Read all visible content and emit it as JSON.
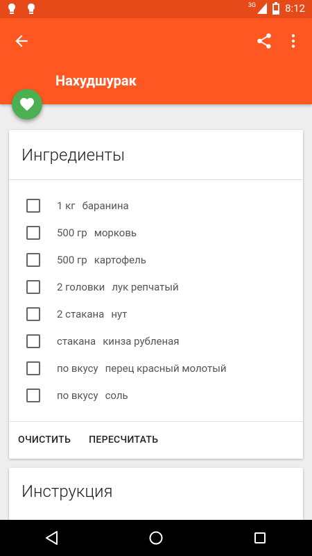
{
  "status_bar": {
    "time": "8:12",
    "network": "3G"
  },
  "app_bar": {
    "title": "Нахудшурак",
    "color": "#ff5722"
  },
  "ingredients_card": {
    "title": "Ингредиенты",
    "items": [
      {
        "qty": "1 кг",
        "name": "баранина"
      },
      {
        "qty": "500 гр",
        "name": "морковь"
      },
      {
        "qty": "500 гр",
        "name": "картофель"
      },
      {
        "qty": "2 головки",
        "name": "лук репчатый"
      },
      {
        "qty": "2 стакана",
        "name": "нут"
      },
      {
        "qty": "стакана",
        "name": "кинза рубленая"
      },
      {
        "qty": "по вкусу",
        "name": "перец красный молотый"
      },
      {
        "qty": "по вкусу",
        "name": "соль"
      }
    ],
    "actions": {
      "clear_label": "ОЧИСТИТЬ",
      "recalc_label": "ПЕРЕСЧИТАТЬ"
    }
  },
  "instructions_card": {
    "title": "Инструкция"
  },
  "icons": {
    "favorite": "heart-icon",
    "back": "arrow-back-icon",
    "share": "share-icon",
    "more": "more-vert-icon"
  }
}
